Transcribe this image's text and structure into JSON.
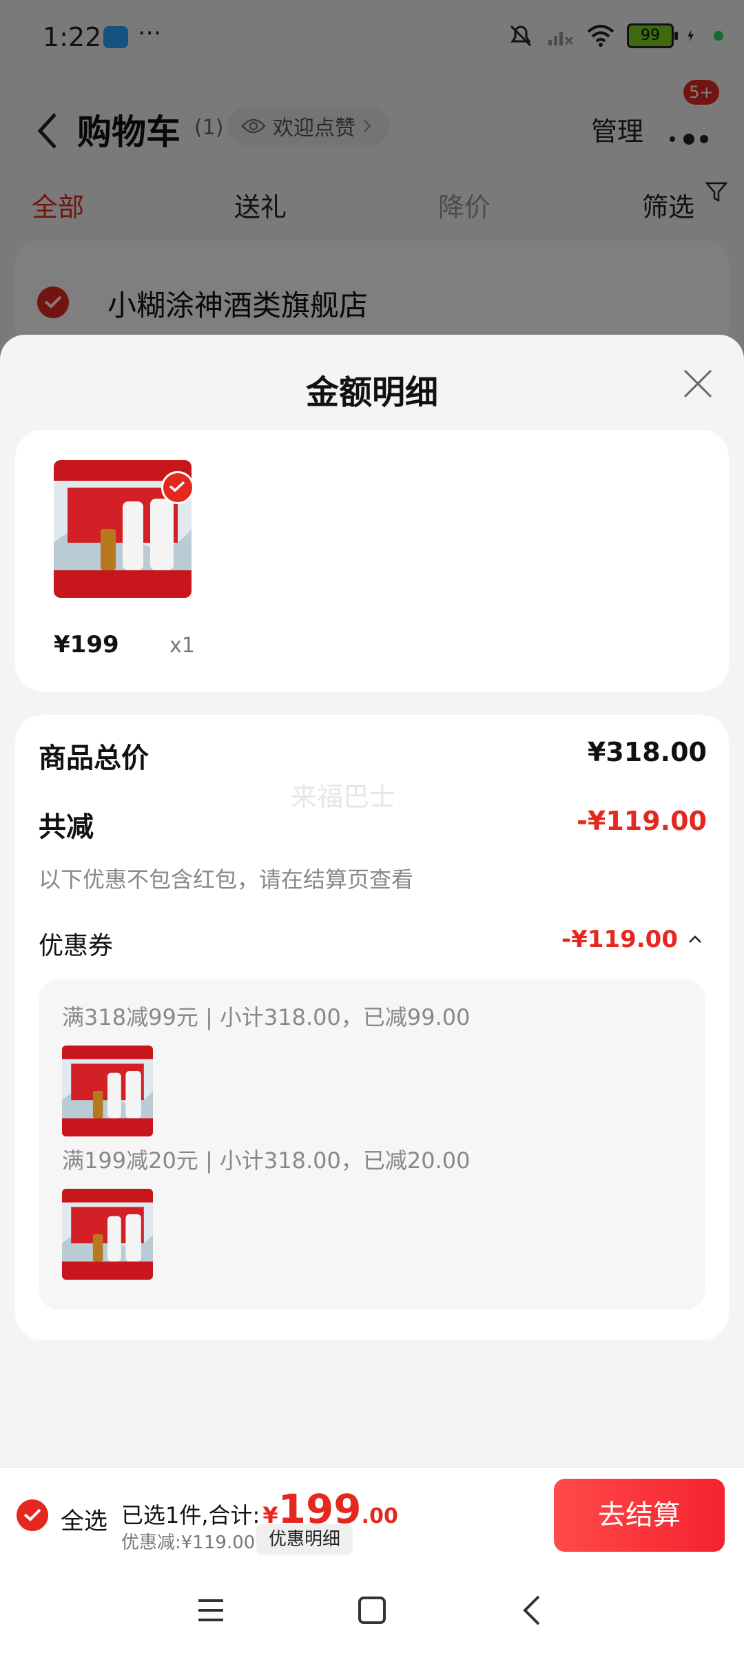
{
  "status_bar": {
    "time": "1:22",
    "dots": "···",
    "battery": "99"
  },
  "header": {
    "title": "购物车",
    "count": "(1)",
    "praise": "欢迎点赞",
    "manage": "管理",
    "badge": "5+"
  },
  "filters": {
    "tabs": [
      "全部",
      "送礼",
      "降价"
    ],
    "filter_label": "筛选"
  },
  "store": {
    "name": "小糊涂神酒类旗舰店"
  },
  "sheet": {
    "title": "金额明细",
    "item": {
      "price": "¥199",
      "qty": "x1"
    },
    "total_label": "商品总价",
    "total_value": "¥318.00",
    "watermark": "来福巴士",
    "discount_label": "共减",
    "discount_value": "-¥119.00",
    "note": "以下优惠不包含红包，请在结算页查看",
    "coupon_label": "优惠券",
    "coupon_value": "-¥119.00",
    "coupons": [
      {
        "text": "满318减99元 | 小计318.00，已减99.00"
      },
      {
        "text": "满199减20元 | 小计318.00，已减20.00"
      }
    ]
  },
  "bottom_bar": {
    "select_all": "全选",
    "summary_prefix": "已选1件,合计:",
    "currency": "¥",
    "total_int": "199",
    "total_dec": ".00",
    "discount_text": "优惠减:¥119.00",
    "detail_chip": "优惠明细",
    "checkout": "去结算"
  },
  "colors": {
    "accent": "#e4281f",
    "sheet_bg": "#f4f4f4"
  }
}
